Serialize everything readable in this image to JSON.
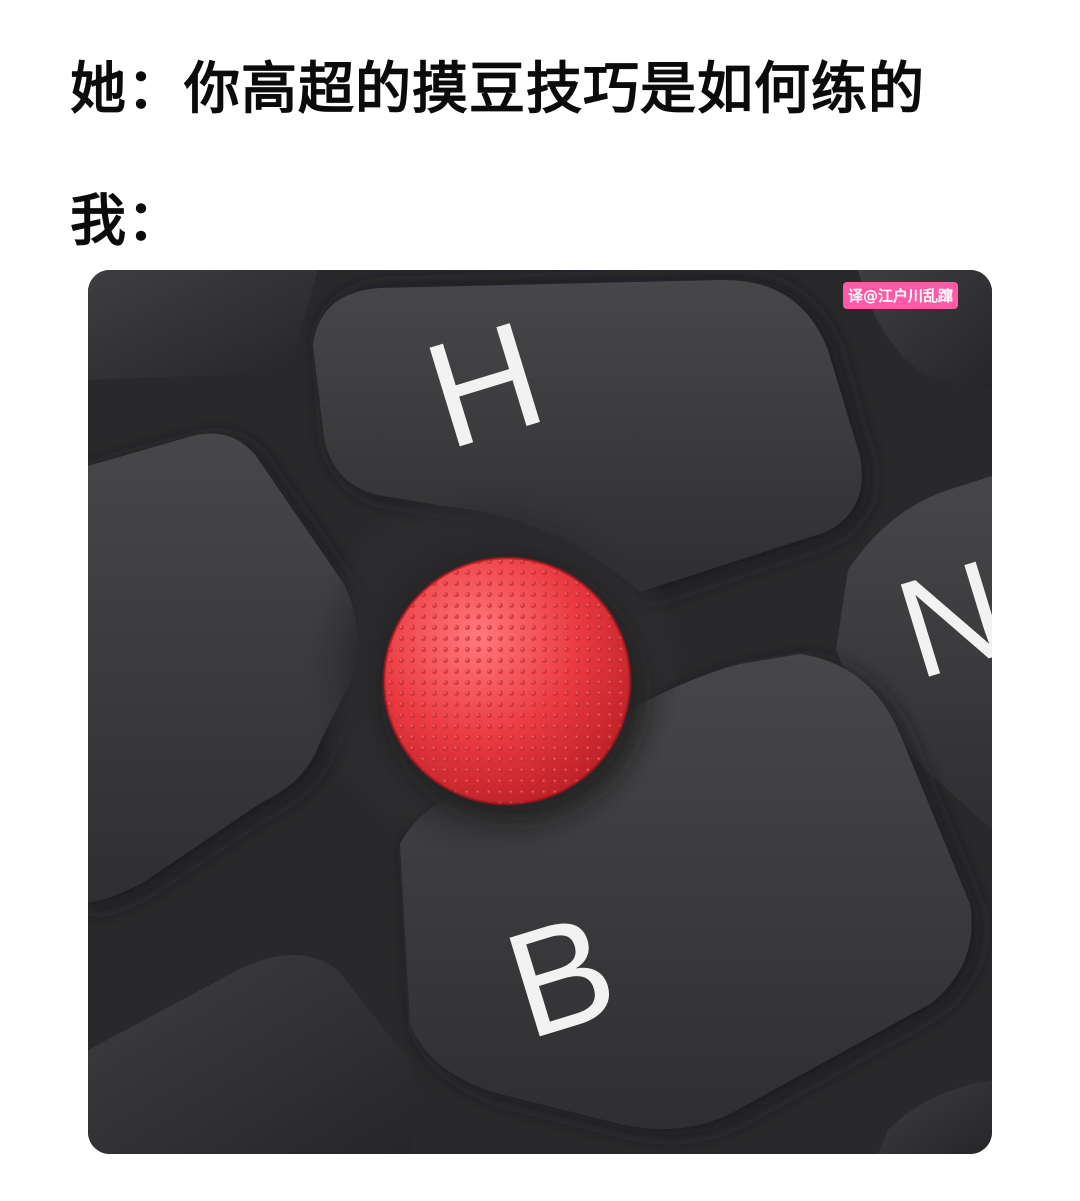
{
  "caption": {
    "line1": "她：你高超的摸豆技巧是如何练的",
    "line2": "我："
  },
  "photo": {
    "watermark": "译@江户川乱蹿",
    "key_legends": {
      "h_key": "H",
      "b_key": "B",
      "n_key_partial": "N"
    },
    "colors": {
      "keyboard_frame": "#2b2b2d",
      "key_cap": "#3a3a3c",
      "key_legend": "#f2f2f2",
      "trackpoint": "#e8393f"
    }
  }
}
